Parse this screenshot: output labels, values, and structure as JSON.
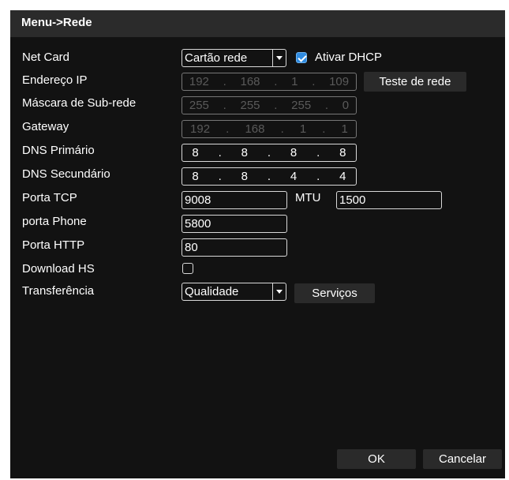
{
  "window": {
    "title": "Menu->Rede"
  },
  "labels": {
    "net_card": "Net Card",
    "ip": "Endereço IP",
    "subnet": "Máscara de Sub-rede",
    "gateway": "Gateway",
    "dns1": "DNS Primário",
    "dns2": "DNS Secundário",
    "tcp_port": "Porta TCP",
    "phone_port": "porta Phone",
    "http_port": "Porta HTTP",
    "download_hs": "Download HS",
    "transfer": "Transferência",
    "mtu": "MTU"
  },
  "fields": {
    "net_card": "Cartão rede",
    "dhcp_label": "Ativar DHCP",
    "dhcp_checked": true,
    "ip": [
      "192",
      "168",
      "1",
      "109"
    ],
    "subnet": [
      "255",
      "255",
      "255",
      "0"
    ],
    "gateway": [
      "192",
      "168",
      "1",
      "1"
    ],
    "dns1": [
      "8",
      "8",
      "8",
      "8"
    ],
    "dns2": [
      "8",
      "8",
      "4",
      "4"
    ],
    "tcp_port": "9008",
    "mtu": "1500",
    "phone_port": "5800",
    "http_port": "80",
    "download_hs_checked": false,
    "transfer": "Qualidade"
  },
  "buttons": {
    "test_network": "Teste de rede",
    "services": "Serviços",
    "ok": "OK",
    "cancel": "Cancelar"
  },
  "colors": {
    "background": "#121212",
    "titlebar": "#2b2b2b",
    "accent": "#2f8be0"
  }
}
